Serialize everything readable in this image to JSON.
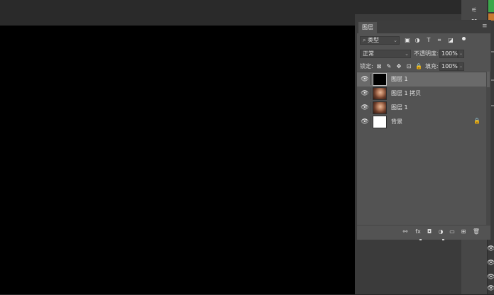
{
  "panel": {
    "tab_label": "图层",
    "menu_icon": "≡",
    "filter": {
      "search_icon": "⌕",
      "kind_label": "类型",
      "dropdown_icon": "⌄"
    },
    "filter_icons": [
      "▣",
      "◑",
      "T",
      "⌗",
      "◪"
    ],
    "blend": {
      "mode_label": "正常",
      "dropdown_icon": "⌄"
    },
    "opacity": {
      "label": "不透明度:",
      "value": "100%",
      "dropdown_icon": "⌄"
    },
    "lock": {
      "label": "锁定:",
      "icons": [
        "⊠",
        "✎",
        "✥",
        "⊡",
        "🔒"
      ]
    },
    "fill": {
      "label": "填充:",
      "value": "100%",
      "dropdown_icon": "⌄"
    },
    "layers": [
      {
        "name": "图层 1",
        "thumb": "black",
        "selected": true
      },
      {
        "name": "图层 1 拷贝",
        "thumb": "photo",
        "selected": false
      },
      {
        "name": "图层 1",
        "thumb": "photo",
        "selected": false
      },
      {
        "name": "背景",
        "thumb": "white",
        "selected": false,
        "locked": true
      }
    ],
    "eye_icon": "👁",
    "lock_icon": "🔒",
    "footer_icons": [
      "⚯",
      "fx",
      "◘",
      "◑",
      "▭",
      "⊞",
      "🗑"
    ]
  },
  "colors": {
    "canvas": "#000000",
    "panel_bg": "#535353",
    "selected_row": "#6a6a6a",
    "accent_green": "#3aa84a",
    "accent_orange": "#c97a30"
  }
}
